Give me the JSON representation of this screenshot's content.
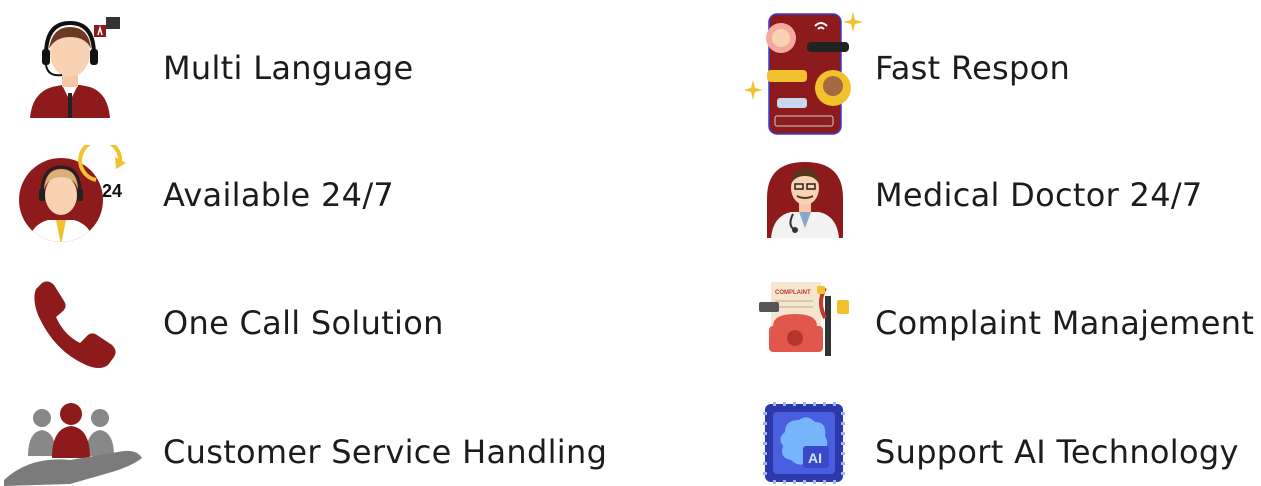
{
  "features": {
    "left": [
      {
        "label": "Multi Language",
        "icon": "headset-agent-translate-icon"
      },
      {
        "label": "Available 24/7",
        "icon": "agent-24-hours-icon"
      },
      {
        "label": "One Call Solution",
        "icon": "phone-handset-icon"
      },
      {
        "label": "Customer Service Handling",
        "icon": "people-on-hand-icon"
      }
    ],
    "right": [
      {
        "label": "Fast Respon",
        "icon": "smartphone-chat-icon"
      },
      {
        "label": "Medical Doctor 24/7",
        "icon": "doctor-icon"
      },
      {
        "label": "Complaint Manajement",
        "icon": "complaint-desk-phone-icon"
      },
      {
        "label": "Support AI Technology",
        "icon": "ai-chip-icon"
      }
    ],
    "icon_text": {
      "badge_24": "24",
      "complaint_form": "COMPLAINT",
      "chip_ai": "AI"
    }
  },
  "colors": {
    "accent_red": "#8e1b1c",
    "gold": "#f2c12e",
    "gray": "#7b7b7b",
    "text": "#1c1c1c"
  }
}
